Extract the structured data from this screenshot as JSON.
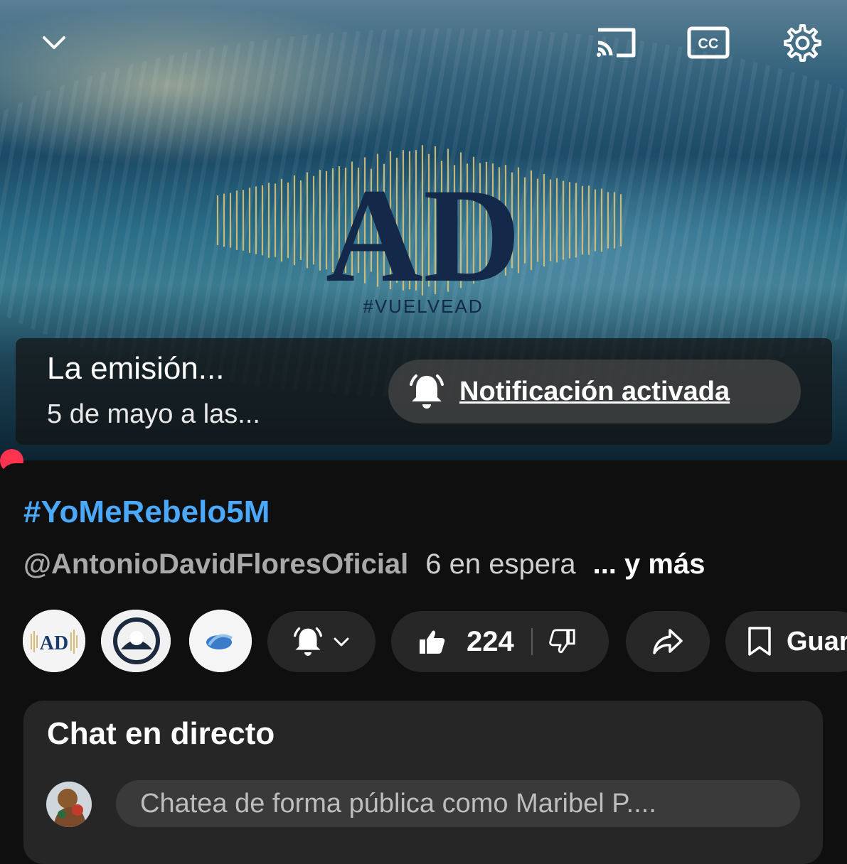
{
  "player": {
    "logo_text": "AD",
    "logo_tag": "#VUELVEAD",
    "icons": [
      "chevron-down-icon",
      "cast-icon",
      "captions-icon",
      "gear-icon"
    ],
    "captions_label": "CC"
  },
  "premiere": {
    "title": "La emisión...",
    "date": "5 de mayo a las...",
    "notification_label": "Notificación activada"
  },
  "video": {
    "title": "#YoMeRebelo5M",
    "channel": "@AntonioDavidFloresOficial",
    "waiting": "6 en espera",
    "more": "... y más"
  },
  "actions": {
    "likes": "224",
    "save_label": "Guar"
  },
  "live_chat": {
    "title": "Chat en directo",
    "input_placeholder": "Chatea de forma pública como Maribel P...."
  },
  "colors": {
    "accent_link": "#4aa8ff",
    "progress": "#ff3350",
    "logo_gold": "#d6c27a",
    "logo_navy": "#14294a"
  }
}
